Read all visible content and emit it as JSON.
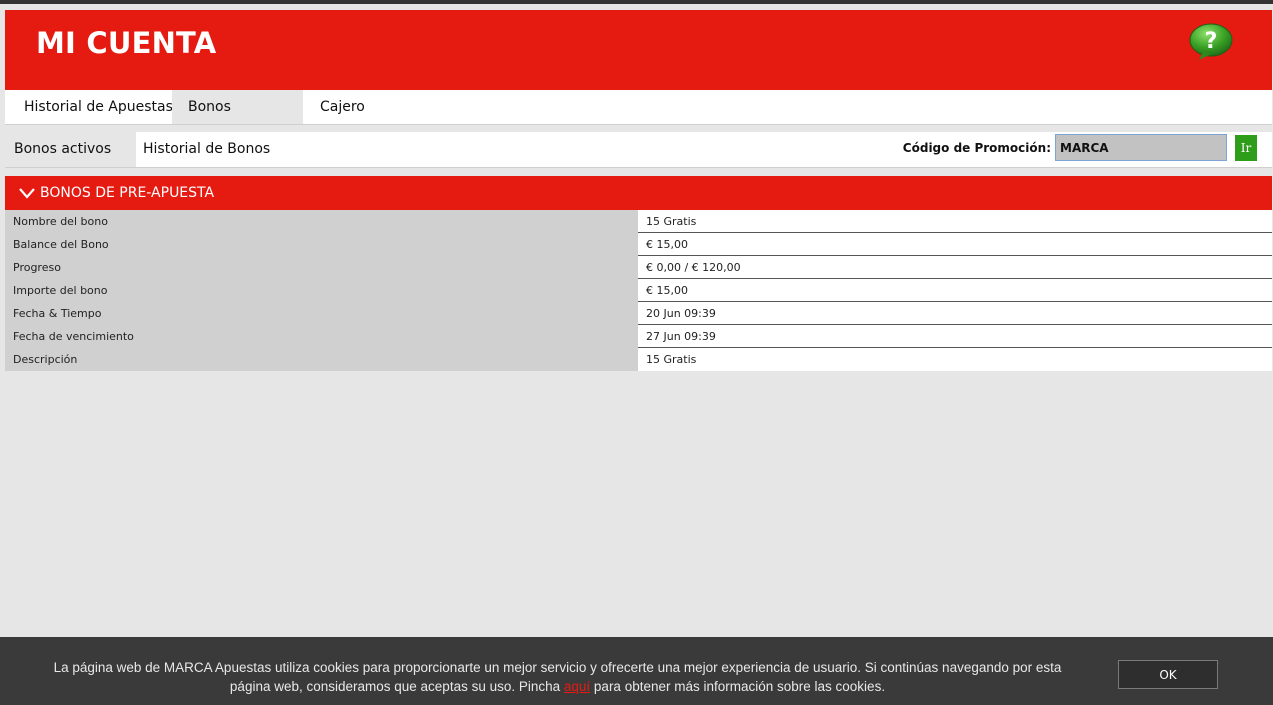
{
  "header": {
    "title": "MI CUENTA",
    "help_icon": "question-bubble-icon",
    "help_glyph": "?"
  },
  "tabs": [
    {
      "label": "Historial de Apuestas",
      "active": false
    },
    {
      "label": "Bonos",
      "active": true
    },
    {
      "label": "Cajero",
      "active": false
    }
  ],
  "subtabs": [
    {
      "label": "Bonos activos",
      "active": true
    },
    {
      "label": "Historial de Bonos",
      "active": false
    }
  ],
  "promo": {
    "label": "Código de Promoción:",
    "value": "MARCA",
    "button_label": "Ir"
  },
  "section": {
    "title": "BONOS DE PRE-APUESTA",
    "icon": "chevron-down-icon"
  },
  "bonus_rows": [
    {
      "key": "Nombre del bono",
      "value": "15 Gratis"
    },
    {
      "key": "Balance del Bono",
      "value": "€ 15,00"
    },
    {
      "key": "Progreso",
      "value": "€ 0,00 / € 120,00"
    },
    {
      "key": "Importe del bono",
      "value": "€ 15,00"
    },
    {
      "key": "Fecha & Tiempo",
      "value": "20 Jun 09:39"
    },
    {
      "key": "Fecha de vencimiento",
      "value": "27 Jun 09:39"
    },
    {
      "key": "Descripción",
      "value": "15 Gratis"
    }
  ],
  "cookie": {
    "text_before": "La página web de MARCA Apuestas utiliza cookies para proporcionarte un mejor servicio y ofrecerte una mejor experiencia de usuario. Si continúas navegando por esta página web, consideramos que aceptas su uso. Pincha ",
    "link": "aquí",
    "text_after": " para obtener más información sobre las cookies.",
    "ok_label": "OK"
  },
  "colors": {
    "brand_red": "#e51b12",
    "go_green": "#2e9d1a",
    "help_green": "#3aa324"
  }
}
